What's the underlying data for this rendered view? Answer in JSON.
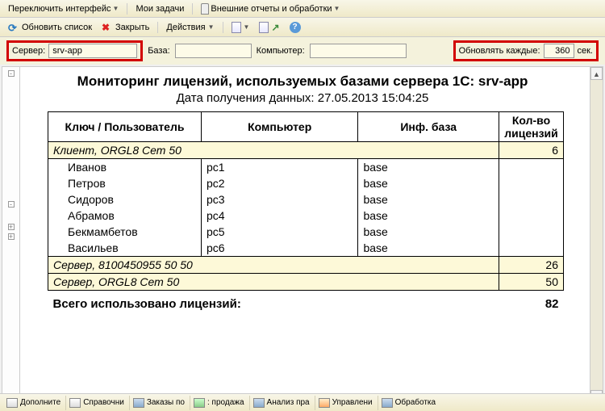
{
  "menu": {
    "switch_ui": "Переключить интерфейс",
    "my_tasks": "Мои задачи",
    "external": "Внешние отчеты и обработки"
  },
  "toolbar": {
    "refresh": "Обновить список",
    "close": "Закрыть",
    "actions": "Действия"
  },
  "filters": {
    "server_label": "Сервер:",
    "server_value": "srv-app",
    "base_label": "База:",
    "base_value": "",
    "computer_label": "Компьютер:",
    "computer_value": "",
    "refresh_every_label": "Обновлять каждые:",
    "refresh_every_value": "360",
    "seconds": "сек."
  },
  "report": {
    "title": "Мониторинг лицензий, используемых базами сервера 1С: srv-app",
    "subtitle": "Дата получения данных: 27.05.2013 15:04:25",
    "columns": {
      "key_user": "Ключ / Пользователь",
      "computer": "Компьютер",
      "base": "Инф. база",
      "count": "Кол-во лицензий"
    },
    "groups": [
      {
        "name": "Клиент, ORGL8 Сет 50",
        "count": "6",
        "rows": [
          {
            "user": "Иванов",
            "pc": "pc1",
            "base": "base"
          },
          {
            "user": "Петров",
            "pc": "pc2",
            "base": "base"
          },
          {
            "user": "Сидоров",
            "pc": "pc3",
            "base": "base"
          },
          {
            "user": "Абрамов",
            "pc": "pc4",
            "base": "base"
          },
          {
            "user": "Бекмамбетов",
            "pc": "pc5",
            "base": "base"
          },
          {
            "user": "Васильев",
            "pc": "pc6",
            "base": "base"
          }
        ]
      },
      {
        "name": "Сервер, 8100450955 50 50",
        "count": "26",
        "rows": []
      },
      {
        "name": "Сервер, ORGL8 Сет 50",
        "count": "50",
        "rows": []
      }
    ],
    "total_label": "Всего использовано лицензий:",
    "total_value": "82"
  },
  "statusbar": {
    "s1": "Дополните",
    "s2": "Справочни",
    "s3": "Заказы по",
    "s4": ": продажа",
    "s5": "Анализ пра",
    "s6": "Управлени",
    "s7": "Обработка"
  }
}
